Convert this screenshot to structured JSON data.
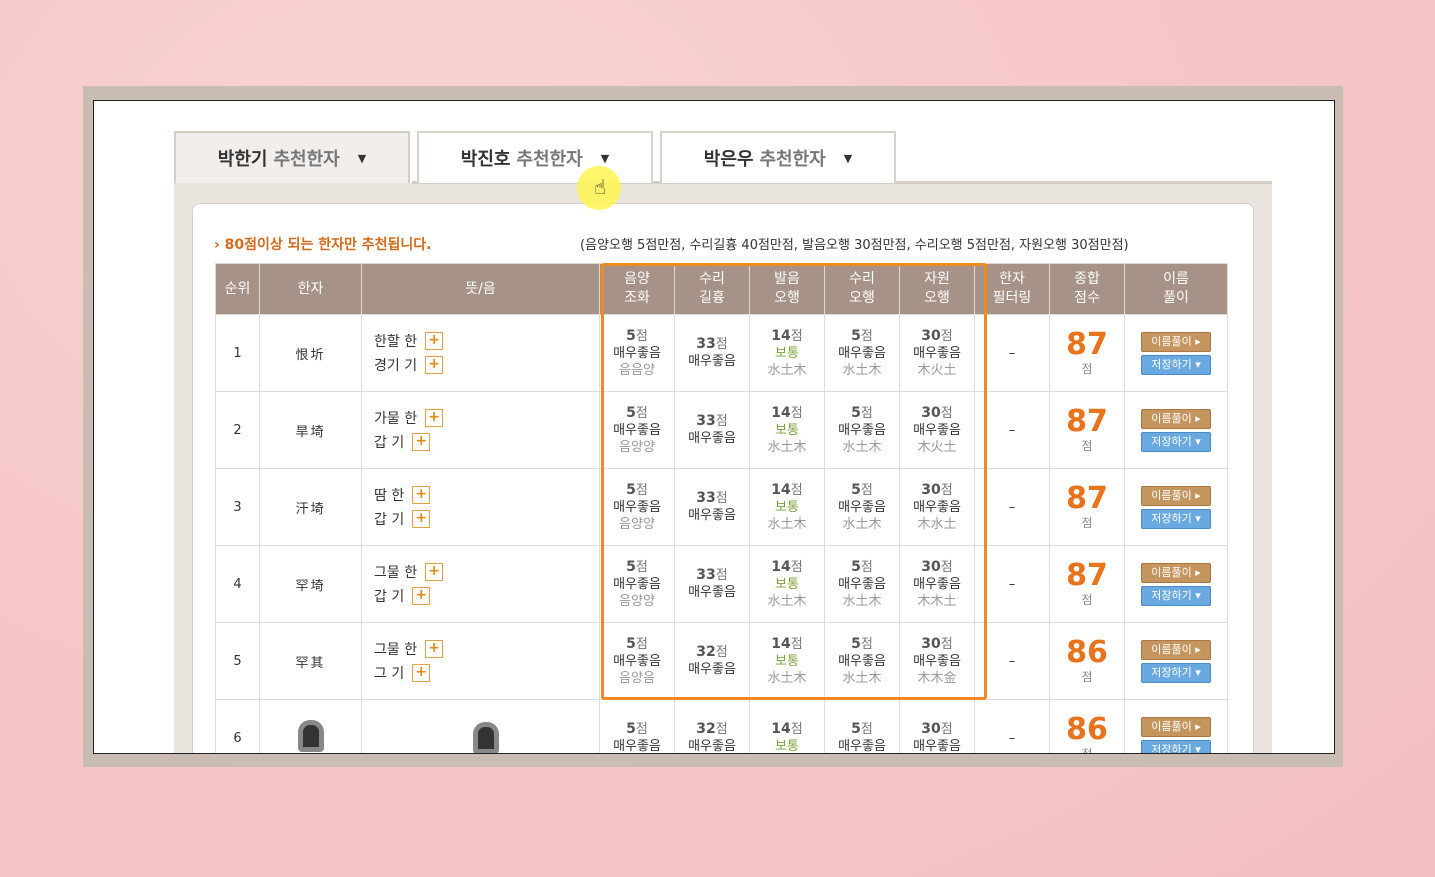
{
  "tabs": [
    {
      "name": "박한기",
      "label": "추천한자",
      "caret": "▼"
    },
    {
      "name": "박진호",
      "label": "추천한자",
      "caret": "▼"
    },
    {
      "name": "박은우",
      "label": "추천한자",
      "caret": "▼"
    }
  ],
  "notice": "› 80점이상 되는 한자만 추천됩니다.",
  "score_info": "(음양오행 5점만점, 수리길흉 40점만점, 발음오행 30점만점, 수리오행 5점만점, 자원오행 30점만점)",
  "headers": {
    "rank": "순위",
    "hanja": "한자",
    "meaning": "뜻/음",
    "yinyang": [
      "음양",
      "조화"
    ],
    "suri": [
      "수리",
      "길흉"
    ],
    "balum": [
      "발음",
      "오행"
    ],
    "suri_oh": [
      "수리",
      "오행"
    ],
    "jawon": [
      "자원",
      "오행"
    ],
    "filter": [
      "한자",
      "필터링"
    ],
    "total": [
      "종합",
      "점수"
    ],
    "explain": [
      "이름",
      "풀이"
    ]
  },
  "unit": "점",
  "btn_explain": "이름풀이 ▸",
  "btn_save": "저장하기 ▾",
  "rows": [
    {
      "rank": "1",
      "hanja": "恨圻",
      "m1": "한할 한",
      "m2": "경기 기",
      "yy": [
        "5",
        "매우좋음",
        "음음양"
      ],
      "sr": [
        "33",
        "매우좋음"
      ],
      "ba": [
        "14",
        "보통",
        "水土木"
      ],
      "so": [
        "5",
        "매우좋음",
        "水土木"
      ],
      "ja": [
        "30",
        "매우좋음",
        "木火土"
      ],
      "filter": "–",
      "total": "87"
    },
    {
      "rank": "2",
      "hanja": "旱埼",
      "m1": "가물 한",
      "m2": "갑 기",
      "yy": [
        "5",
        "매우좋음",
        "음양양"
      ],
      "sr": [
        "33",
        "매우좋음"
      ],
      "ba": [
        "14",
        "보통",
        "水土木"
      ],
      "so": [
        "5",
        "매우좋음",
        "水土木"
      ],
      "ja": [
        "30",
        "매우좋음",
        "木火土"
      ],
      "filter": "–",
      "total": "87"
    },
    {
      "rank": "3",
      "hanja": "汗埼",
      "m1": "땀 한",
      "m2": "갑 기",
      "yy": [
        "5",
        "매우좋음",
        "음양양"
      ],
      "sr": [
        "33",
        "매우좋음"
      ],
      "ba": [
        "14",
        "보통",
        "水土木"
      ],
      "so": [
        "5",
        "매우좋음",
        "水土木"
      ],
      "ja": [
        "30",
        "매우좋음",
        "木水土"
      ],
      "filter": "–",
      "total": "87"
    },
    {
      "rank": "4",
      "hanja": "罕埼",
      "m1": "그물 한",
      "m2": "갑 기",
      "yy": [
        "5",
        "매우좋음",
        "음양양"
      ],
      "sr": [
        "33",
        "매우좋음"
      ],
      "ba": [
        "14",
        "보통",
        "水土木"
      ],
      "so": [
        "5",
        "매우좋음",
        "水土木"
      ],
      "ja": [
        "30",
        "매우좋음",
        "木木土"
      ],
      "filter": "–",
      "total": "87"
    },
    {
      "rank": "5",
      "hanja": "罕其",
      "m1": "그물 한",
      "m2": "그 기",
      "yy": [
        "5",
        "매우좋음",
        "음양음"
      ],
      "sr": [
        "32",
        "매우좋음"
      ],
      "ba": [
        "14",
        "보통",
        "水土木"
      ],
      "so": [
        "5",
        "매우좋음",
        "水土木"
      ],
      "ja": [
        "30",
        "매우좋음",
        "木木金"
      ],
      "filter": "–",
      "total": "86"
    },
    {
      "rank": "6",
      "hanja": "",
      "m1": "",
      "m2": "",
      "yy": [
        "5",
        "매우좋음",
        ""
      ],
      "sr": [
        "32",
        "매우좋음"
      ],
      "ba": [
        "14",
        "보통",
        ""
      ],
      "so": [
        "5",
        "매우좋음",
        ""
      ],
      "ja": [
        "30",
        "매우좋음",
        ""
      ],
      "filter": "–",
      "total": "86"
    }
  ]
}
